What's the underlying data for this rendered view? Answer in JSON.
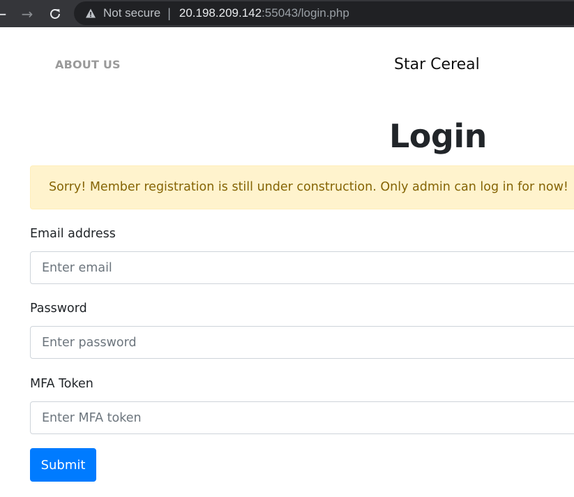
{
  "browser": {
    "back_glyph": "←",
    "forward_glyph": "→",
    "security_label": "Not secure",
    "separator": "|",
    "url_host": "20.198.209.142",
    "url_rest": ":55043/login.php"
  },
  "nav": {
    "about_label": "ABOUT US",
    "brand": "Star Cereal"
  },
  "page": {
    "title": "Login",
    "alert": "Sorry! Member registration is still under construction. Only admin can log in for now!"
  },
  "form": {
    "email": {
      "label": "Email address",
      "value": "",
      "placeholder": "Enter email"
    },
    "password": {
      "label": "Password",
      "value": "",
      "placeholder": "Enter password"
    },
    "mfa": {
      "label": "MFA Token",
      "value": "",
      "placeholder": "Enter MFA token"
    },
    "submit_label": "Submit"
  },
  "icons": {
    "back": "arrow-left-icon",
    "forward": "arrow-right-icon",
    "reload": "reload-icon",
    "security": "warning-triangle-icon"
  },
  "colors": {
    "chrome_bg": "#35363a",
    "omnibox_bg": "#202124",
    "alert_bg": "#fff3cd",
    "alert_text": "#856404",
    "primary": "#007bff"
  }
}
